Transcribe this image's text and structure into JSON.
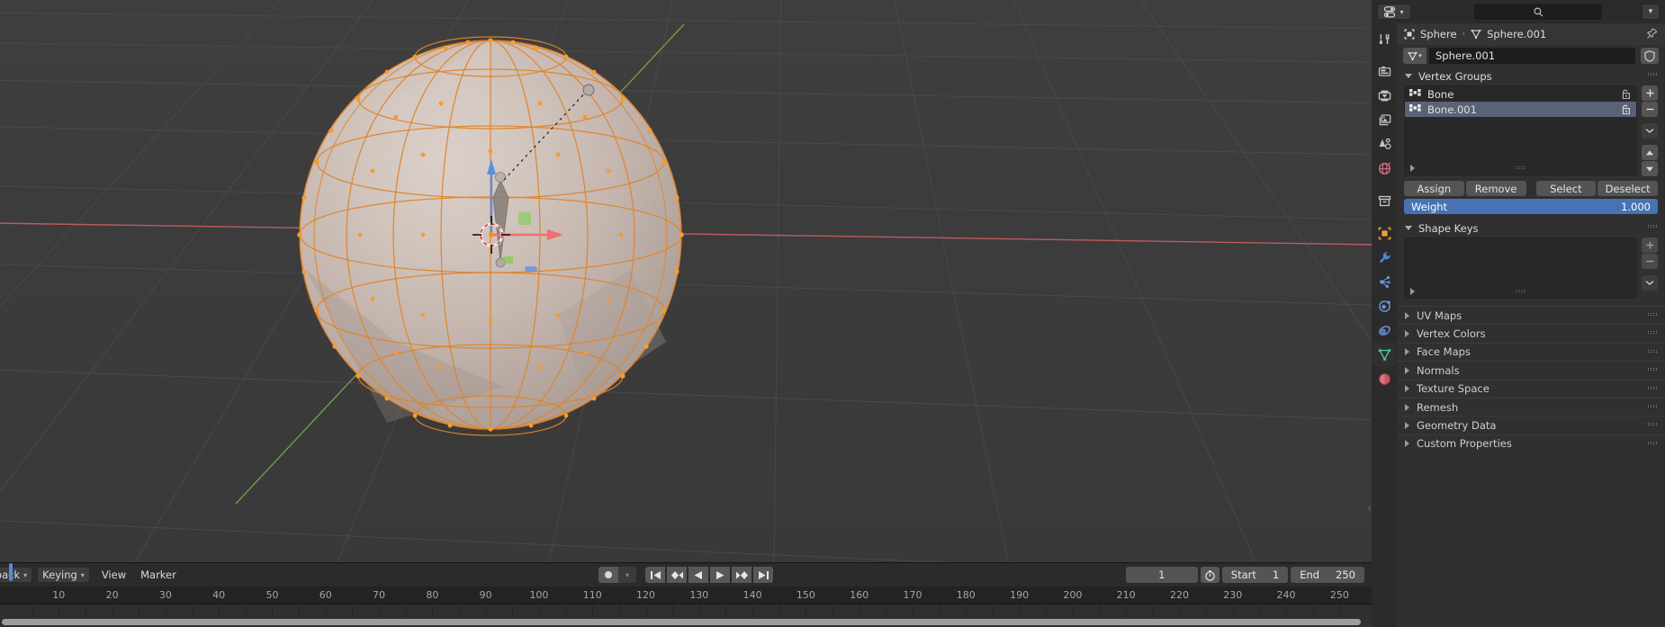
{
  "app": {
    "name": "Blender",
    "mode": "Edit Mode"
  },
  "viewport": {
    "name": "3d-viewport",
    "background_color": "#3b3b3b",
    "grid_color": "#4e4e4e",
    "x_axis_color": "#c35b62",
    "y_axis_color": "#6fa04a",
    "object_name": "Sphere",
    "mesh_color": "#c7b9b0",
    "selection_color": "#ee8b29",
    "cursor_label": "3d-cursor",
    "gizmo": {
      "x_color": "#f06e74",
      "y_color": "#86cc52",
      "z_color": "#5b8fe0"
    }
  },
  "timeline": {
    "name": "timeline-editor",
    "menus": [
      {
        "label": "yback",
        "type": "dropdown"
      },
      {
        "label": "Keying",
        "type": "dropdown"
      },
      {
        "label": "View",
        "type": "menu"
      },
      {
        "label": "Marker",
        "type": "menu"
      }
    ],
    "record_button": "auto-keying-toggle",
    "playback_buttons": [
      "jump-to-start",
      "jump-to-prev-keyframe",
      "play-reverse",
      "play",
      "jump-to-next-keyframe",
      "jump-to-end"
    ],
    "current_frame": "1",
    "start_label": "Start",
    "start_value": "1",
    "end_label": "End",
    "end_value": "250",
    "ticks": [
      {
        "label": "10",
        "frame": 10
      },
      {
        "label": "20",
        "frame": 20
      },
      {
        "label": "30",
        "frame": 30
      },
      {
        "label": "40",
        "frame": 40
      },
      {
        "label": "50",
        "frame": 50
      },
      {
        "label": "60",
        "frame": 60
      },
      {
        "label": "70",
        "frame": 70
      },
      {
        "label": "80",
        "frame": 80
      },
      {
        "label": "90",
        "frame": 90
      },
      {
        "label": "100",
        "frame": 100
      },
      {
        "label": "110",
        "frame": 110
      },
      {
        "label": "120",
        "frame": 120
      },
      {
        "label": "130",
        "frame": 130
      },
      {
        "label": "140",
        "frame": 140
      },
      {
        "label": "150",
        "frame": 150
      },
      {
        "label": "160",
        "frame": 160
      },
      {
        "label": "170",
        "frame": 170
      },
      {
        "label": "180",
        "frame": 180
      },
      {
        "label": "190",
        "frame": 190
      },
      {
        "label": "200",
        "frame": 200
      },
      {
        "label": "210",
        "frame": 210
      },
      {
        "label": "220",
        "frame": 220
      },
      {
        "label": "230",
        "frame": 230
      },
      {
        "label": "240",
        "frame": 240
      },
      {
        "label": "250",
        "frame": 250
      }
    ],
    "playhead_frame": 1
  },
  "properties": {
    "name": "properties-editor",
    "editor_type_icon": "properties-editor-icon",
    "search_placeholder": "",
    "header_chevron": "chevron-down-icon",
    "tabs": [
      {
        "id": "tool",
        "icon": "tool-icon",
        "active": false,
        "color": "#c3c3c3"
      },
      {
        "id": "render",
        "icon": "render-camera-icon",
        "active": false,
        "color": "#c3c3c3"
      },
      {
        "id": "output",
        "icon": "output-printer-icon",
        "active": false,
        "color": "#c3c3c3"
      },
      {
        "id": "view-layer",
        "icon": "view-layer-images-icon",
        "active": false,
        "color": "#c3c3c3"
      },
      {
        "id": "scene",
        "icon": "scene-cone-icon",
        "active": false,
        "color": "#c3c3c3"
      },
      {
        "id": "world",
        "icon": "world-globe-icon",
        "active": false,
        "color": "#cc6a7a"
      },
      {
        "id": "collection",
        "icon": "collection-box-icon",
        "active": false,
        "color": "#c3c3c3"
      },
      {
        "id": "object",
        "icon": "object-square-icon",
        "active": false,
        "color": "#e8a33d"
      },
      {
        "id": "modifiers",
        "icon": "wrench-icon",
        "active": false,
        "color": "#4f83d6"
      },
      {
        "id": "particles",
        "icon": "particles-icon",
        "active": false,
        "color": "#6b9ae0"
      },
      {
        "id": "physics",
        "icon": "physics-orbit-icon",
        "active": false,
        "color": "#6b9ae0"
      },
      {
        "id": "constraints",
        "icon": "object-constraints-icon",
        "active": false,
        "color": "#6b9ae0"
      },
      {
        "id": "data",
        "icon": "mesh-data-triangle-icon",
        "active": true,
        "color": "#4cc98a"
      },
      {
        "id": "material",
        "icon": "material-sphere-icon",
        "active": false,
        "color": "#cc5560"
      }
    ],
    "breadcrumb": {
      "object_icon": "object-square-icon",
      "object": "Sphere",
      "separator": "›",
      "data_icon": "mesh-data-triangle-icon",
      "data": "Sphere.001",
      "pin_icon": "pin-icon"
    },
    "datablock": {
      "prefix_icon": "mesh-data-triangle-icon",
      "name": "Sphere.001",
      "shield_icon": "fake-user-shield-icon"
    },
    "vertex_groups": {
      "title": "Vertex Groups",
      "expanded": true,
      "items": [
        {
          "name": "Bone",
          "selected": false,
          "lock_icon": "unlocked-padlock-icon"
        },
        {
          "name": "Bone.001",
          "selected": true,
          "lock_icon": "unlocked-padlock-icon"
        }
      ],
      "side_buttons": [
        {
          "id": "add",
          "icon": "plus-icon",
          "glyph": "+"
        },
        {
          "id": "remove",
          "icon": "minus-icon",
          "glyph": "−"
        },
        {
          "id": "specials",
          "icon": "chevron-down-icon",
          "glyph": ""
        },
        {
          "id": "move-up",
          "icon": "triangle-up-icon",
          "glyph": ""
        },
        {
          "id": "move-down",
          "icon": "triangle-down-icon",
          "glyph": ""
        }
      ],
      "action_buttons": [
        "Assign",
        "Remove",
        "Select",
        "Deselect"
      ],
      "weight": {
        "label": "Weight",
        "value": "1.000",
        "fill_color": "#4772b3"
      }
    },
    "shape_keys": {
      "title": "Shape Keys",
      "expanded": true,
      "items": []
    },
    "collapsed_panels": [
      "UV Maps",
      "Vertex Colors",
      "Face Maps",
      "Normals",
      "Texture Space",
      "Remesh",
      "Geometry Data",
      "Custom Properties"
    ]
  }
}
